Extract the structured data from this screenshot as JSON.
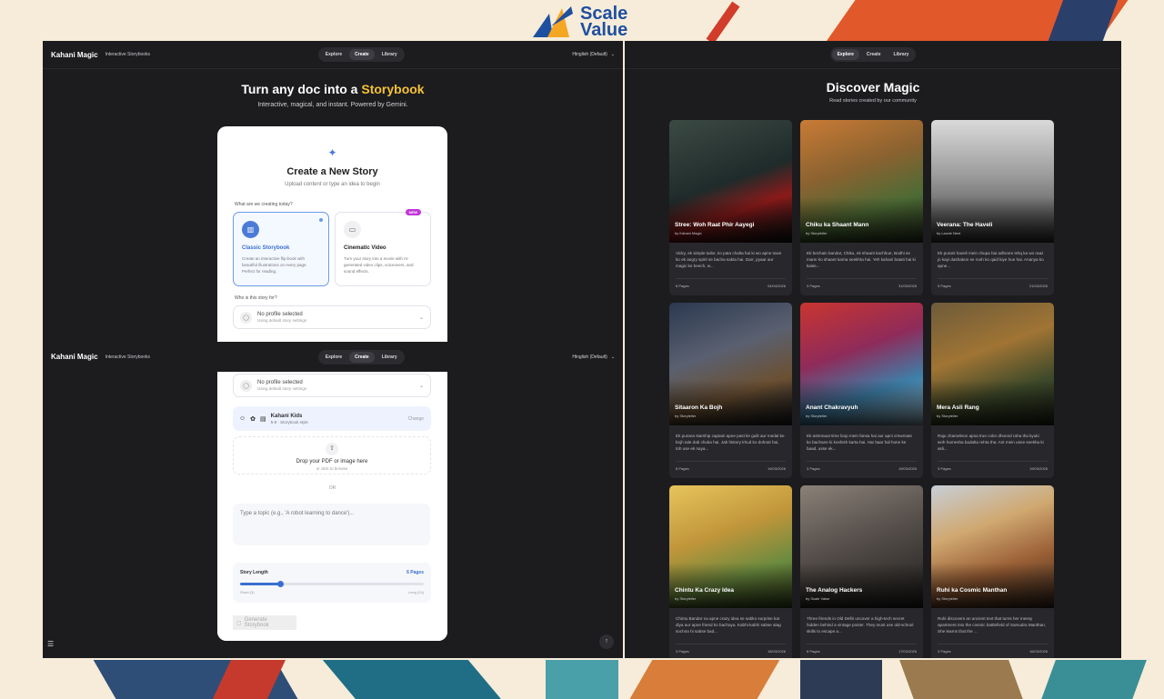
{
  "logo": {
    "line1": "Scale",
    "line2": "Value"
  },
  "app": {
    "name": "Kahani Magic",
    "subtitle": "Interactive Storybooks",
    "nav": [
      "Explore",
      "Create",
      "Library"
    ],
    "language": "Hinglish (Default)"
  },
  "create": {
    "hero_title_prefix": "Turn any doc into a",
    "hero_title_highlight": "Storybook",
    "hero_subtitle": "Interactive, magical, and instant. Powered by Gemini.",
    "card_title": "Create a New Story",
    "card_subtitle": "Upload content or type an idea to begin",
    "type_label": "What are we creating today?",
    "types": [
      {
        "name": "Classic Storybook",
        "desc": "Create an interactive flip-book with beautiful illustrations on every page. Perfect for reading."
      },
      {
        "name": "Cinematic Video",
        "desc": "Turn your story into a movie with AI-generated video clips, voiceovers, and sound effects.",
        "badge": "NEW"
      }
    ],
    "audience_label": "Who is this story for?",
    "profile": {
      "main": "No profile selected",
      "sub": "Using default story settings"
    },
    "kids": {
      "name": "Kahani Kids",
      "sub": "5-8 · Storybook style",
      "change": "Change"
    },
    "drop": {
      "main": "Drop your PDF or image here",
      "sub": "or click to browse"
    },
    "or_text": "OR",
    "topic_placeholder": "Type a topic (e.g., 'A robot learning to dance')...",
    "length": {
      "label": "Story Length",
      "value_label": "6 Pages",
      "value": 0.22,
      "min_label": "Short (3)",
      "max_label": "Long (24)"
    },
    "generate_label": "Generate Storybook"
  },
  "discover": {
    "title": "Discover Magic",
    "subtitle": "Read stories created by our community",
    "stories": [
      {
        "title": "Stree: Woh Raat Phir Aayegi",
        "by": "by Kahani Magic",
        "desc": "Vicky, ek simple tailor, ko pata chalta hai ki wo apne town ko ek angry spirit se bacha sakta hai. Darr, pyaar aur magic ke beech, w...",
        "pages": "8 Pages",
        "date": "04/04/2026"
      },
      {
        "title": "Chiku ka Shaant Mann",
        "by": "by Storyteller",
        "desc": "Ek bechain bandar, Chiku, ek shaant kachhue, Bodhi se mann ko shaant karna seekhta hai. Yeh kahani batati hai ki kaise...",
        "pages": "3 Pages",
        "date": "31/03/2026"
      },
      {
        "title": "Veerana: The Haveli",
        "by": "by Laxxie Next",
        "desc": "Ek purani haveli mein chupa hai adhoore ishq ka wo raaz jo kayi dashakon se rooh ko qaid kiye hue hai. Ananya ko apne...",
        "pages": "5 Pages",
        "date": "21/03/2026"
      },
      {
        "title": "Sitaaron Ka Bojh",
        "by": "by Storyteller",
        "desc": "Ek purana starship captain apne past ke guilt aur medal ke bojh tale dab chuka hai. Jab history khud ko dohrati hai, toh use ek naya...",
        "pages": "8 Pages",
        "date": "19/03/2026"
      },
      {
        "title": "Anant Chakravyuh",
        "by": "by Storyteller",
        "desc": "Ek astronaut time loop mein fansa hai aur apni crewmate ko bachane ki koshish karta hai. Har baar fail hone ke baad, usse ek...",
        "pages": "3 Pages",
        "date": "19/03/2026"
      },
      {
        "title": "Mera Asli Rang",
        "by": "by Storyteller",
        "desc": "Raju chameleon apna true color dhoond raha tha kyuki woh hamesha badalta rehta tha. Ant mein usne seekha ki asli...",
        "pages": "3 Pages",
        "date": "19/03/2026"
      },
      {
        "title": "Chintu Ka Crazy Idea",
        "by": "by Storyteller",
        "desc": "Chintu Bandar na apne crazy idea se sabko surprise kar diya aur apne friend ko bachaya. Kabhi-kabhi sabse alag sochna hi sabse bad...",
        "pages": "3 Pages",
        "date": "18/03/2026"
      },
      {
        "title": "The Analog Hackers",
        "by": "by Scale Value",
        "desc": "Three friends in Old Delhi uncover a high-tech secret hidden behind a vintage poster. They must use old-school skills to escape a...",
        "pages": "8 Pages",
        "date": "17/03/2026"
      },
      {
        "title": "Ruhi ka Cosmic Manthan",
        "by": "by Storyteller",
        "desc": "Ruhi discovers an ancient text that turns her messy apartment into the cosmic battlefield of Samudra Manthan. She learns that the ...",
        "pages": "3 Pages",
        "date": "16/03/2026"
      }
    ]
  }
}
